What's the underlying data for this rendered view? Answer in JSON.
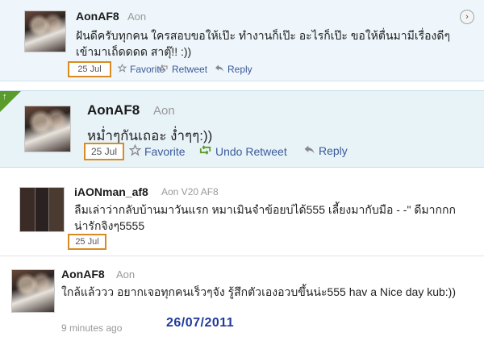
{
  "tweets": [
    {
      "username": "AonAF8",
      "fullname": "Aon",
      "text": "ฝันดีครับทุกคน ใครสอบขอให้เป๊ะ ทำงานก็เป๊ะ อะไรก็เป๊ะ ขอให้ตื่นมามีเรื่องดีๆเข้ามาเถ็ดดดด สาตุ๊!! :))",
      "date": "25 Jul",
      "actions": [
        "Favorite",
        "Retweet",
        "Reply"
      ]
    },
    {
      "username": "AonAF8",
      "fullname": "Aon",
      "text": "หม่ำๆกันเถอะ ง่ำๆๆ:))",
      "date": "25 Jul",
      "actions": [
        "Favorite",
        "Undo Retweet",
        "Reply"
      ]
    },
    {
      "username": "iAONman_af8",
      "fullname": "Aon V20 AF8",
      "text": "ลืมเล่าว่ากลับบ้านมาวันแรก หมาเมินจำข้อยบ่ได้555 เลี้ยงมากับมือ - -\" ดีมากกก น่ารักจิงๆ5555",
      "date": "25 Jul"
    },
    {
      "username": "AonAF8",
      "fullname": "Aon",
      "text": "ใกล้แล้ววว อยากเจอทุกคนเร็วๆจัง รู้สึกตัวเองอวบขึ้นน่ะ555 hav a Nice day kub:))",
      "time_ago": "9 minutes ago"
    }
  ],
  "stamp": "26/07/2011",
  "icons": {
    "expand": "chevron-right-icon",
    "favorite": "star-icon",
    "retweet": "retweet-icon",
    "reply": "reply-icon",
    "retweeted_flag": "retweet-flag-icon"
  },
  "colors": {
    "link": "#3b5998",
    "retweet_green": "#5a9c2b",
    "date_highlight": "#d98b21",
    "stamp_blue": "#1f3a9a"
  }
}
